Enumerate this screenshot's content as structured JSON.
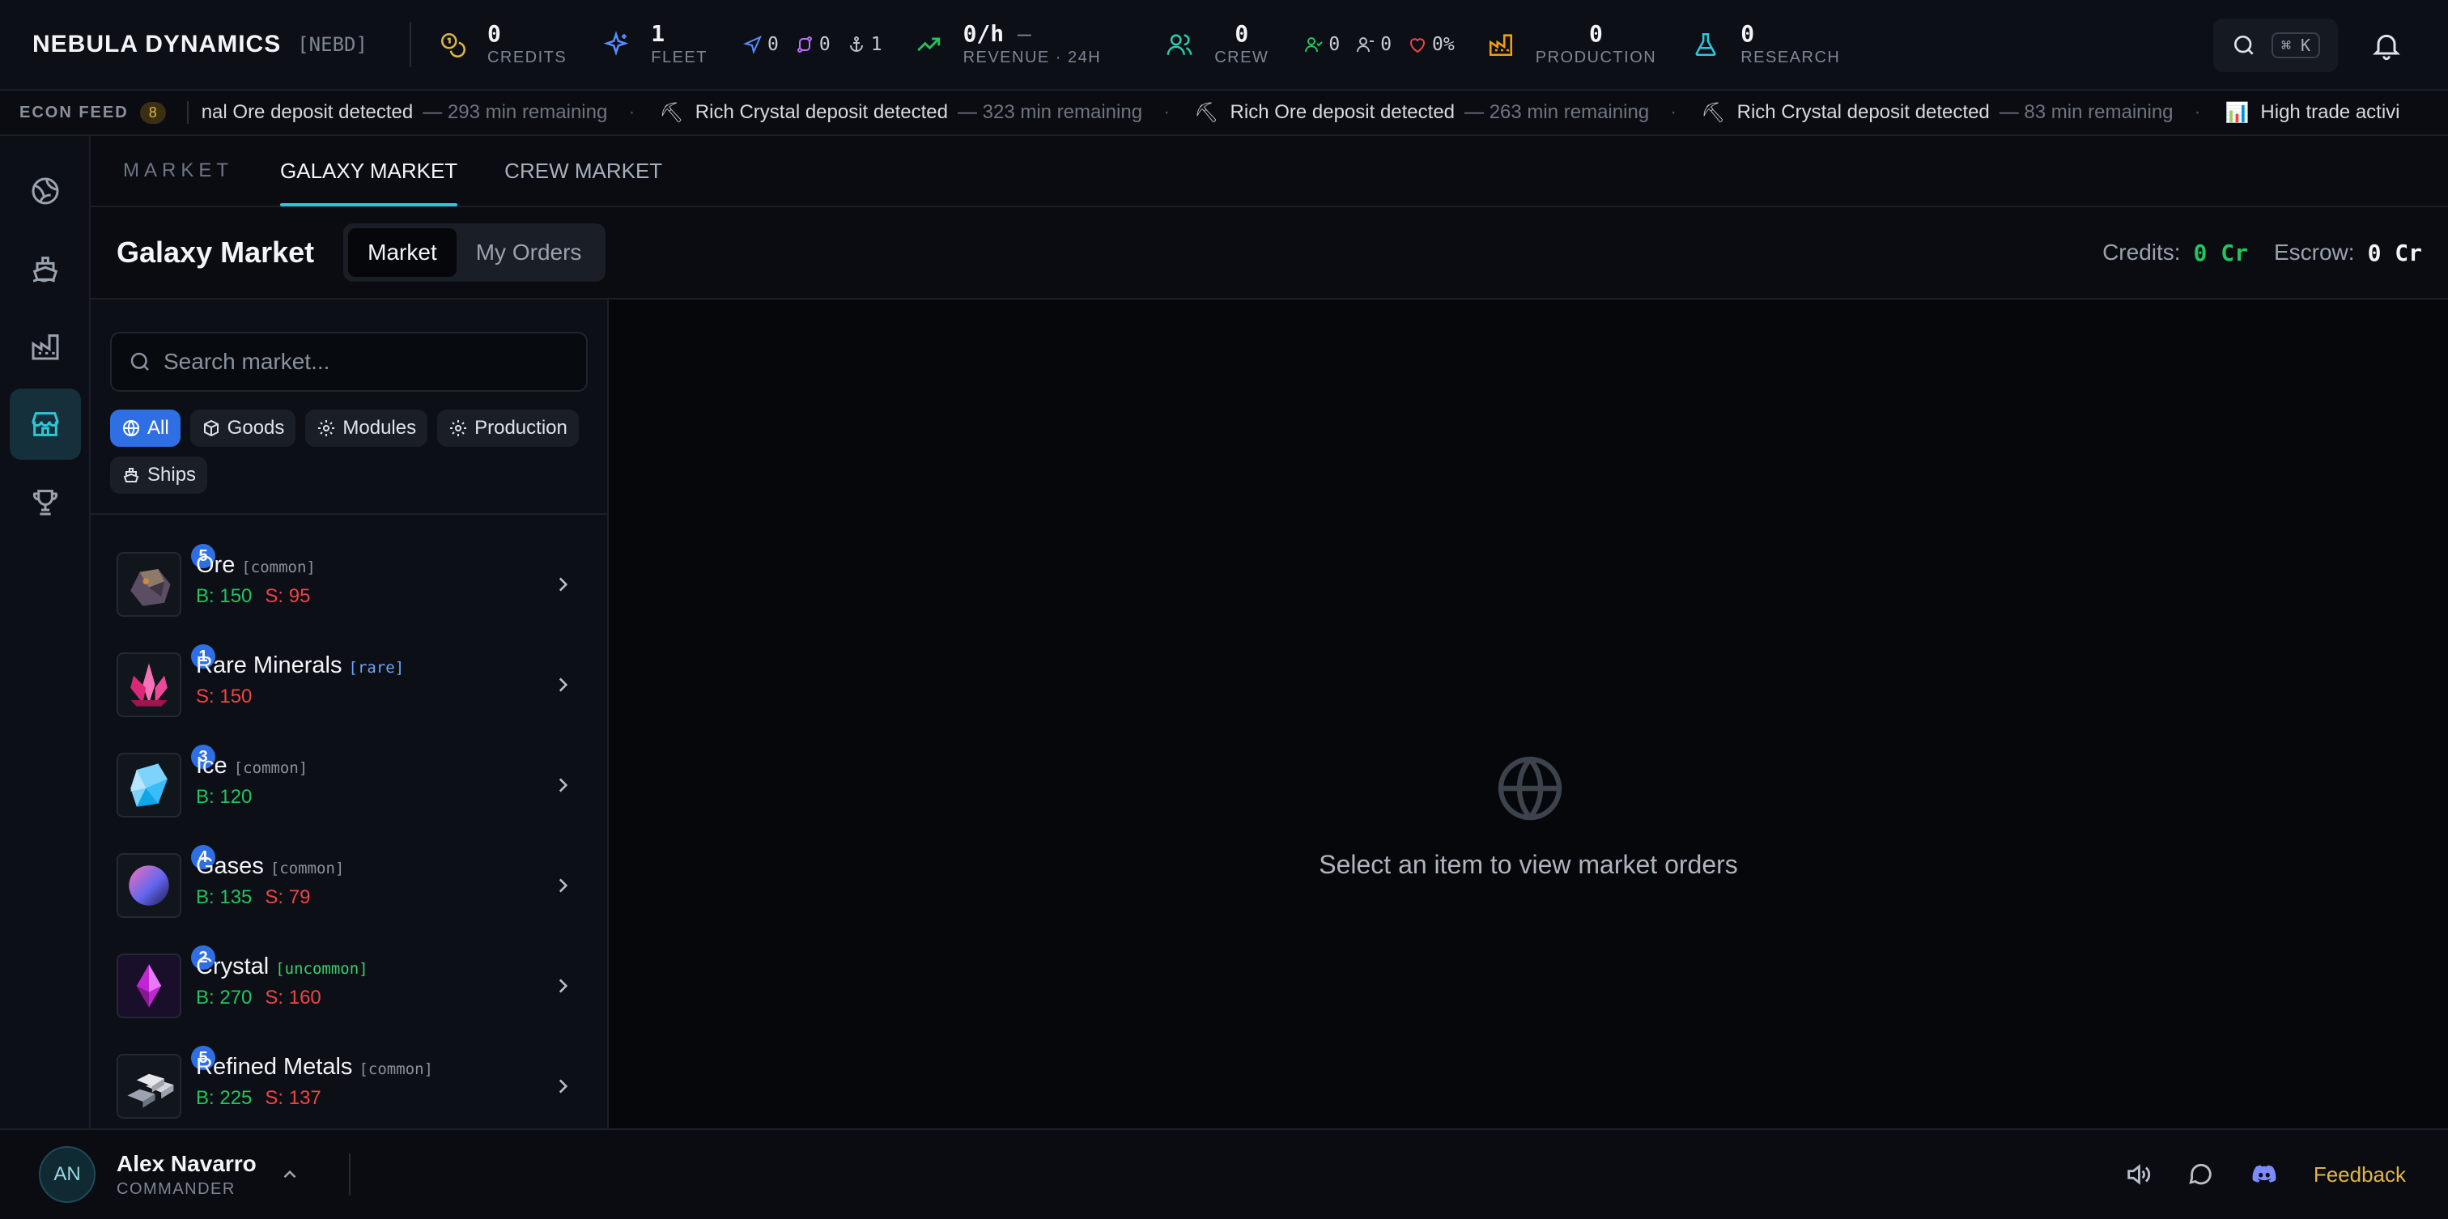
{
  "brand": {
    "name": "NEBULA DYNAMICS",
    "ticker": "[NEBD]"
  },
  "stats": {
    "credits": {
      "value": "0",
      "label": "CREDITS"
    },
    "fleet": {
      "value": "1",
      "label": "FLEET"
    },
    "fleet_minis": [
      "0",
      "0",
      "1"
    ],
    "revenue": {
      "value": "0/h",
      "trend": "—",
      "label": "REVENUE · 24H"
    },
    "crew": {
      "value": "0",
      "label": "CREW"
    },
    "crew_minis": [
      "0",
      "0",
      "0%"
    ],
    "production": {
      "value": "0",
      "label": "PRODUCTION"
    },
    "research": {
      "value": "0",
      "label": "RESEARCH"
    }
  },
  "search_shortcut": "⌘ K",
  "feed": {
    "label": "ECON FEED",
    "count": "8",
    "items": [
      {
        "icon": "mining-pick-icon",
        "text": "nal Ore deposit detected",
        "remaining": "— 293 min remaining"
      },
      {
        "icon": "mining-pick-icon",
        "text": "Rich Crystal deposit detected",
        "remaining": "— 323 min remaining"
      },
      {
        "icon": "mining-pick-icon",
        "text": "Rich Ore deposit detected",
        "remaining": "— 263 min remaining"
      },
      {
        "icon": "mining-pick-icon",
        "text": "Rich Crystal deposit detected",
        "remaining": "— 83 min remaining"
      },
      {
        "icon": "chart-icon",
        "text": "High trade activi",
        "remaining": ""
      }
    ]
  },
  "tabs": {
    "heading": "MARKET",
    "items": [
      "GALAXY MARKET",
      "CREW MARKET"
    ],
    "active": "GALAXY MARKET"
  },
  "header": {
    "title": "Galaxy Market",
    "segments": [
      "Market",
      "My Orders"
    ],
    "active_segment": "Market",
    "credits_label": "Credits:",
    "credits_value": "0 Cr",
    "escrow_label": "Escrow:",
    "escrow_value": "0 Cr"
  },
  "search": {
    "placeholder": "Search market..."
  },
  "filters": [
    "All",
    "Goods",
    "Modules",
    "Production",
    "Ships"
  ],
  "active_filter": "All",
  "items": [
    {
      "name": "Ore",
      "rarity": "[common]",
      "rarity_class": "common",
      "count": "5",
      "buy": "B: 150",
      "sell": "S: 95",
      "icon": "ore-icon"
    },
    {
      "name": "Rare Minerals",
      "rarity": "[rare]",
      "rarity_class": "rare",
      "count": "1",
      "buy": "",
      "sell": "S: 150",
      "icon": "rare-minerals-icon"
    },
    {
      "name": "Ice",
      "rarity": "[common]",
      "rarity_class": "common",
      "count": "3",
      "buy": "B: 120",
      "sell": "",
      "icon": "ice-icon"
    },
    {
      "name": "Gases",
      "rarity": "[common]",
      "rarity_class": "common",
      "count": "4",
      "buy": "B: 135",
      "sell": "S: 79",
      "icon": "gases-icon"
    },
    {
      "name": "Crystal",
      "rarity": "[uncommon]",
      "rarity_class": "uncommon",
      "count": "2",
      "buy": "B: 270",
      "sell": "S: 160",
      "icon": "crystal-icon"
    },
    {
      "name": "Refined Metals",
      "rarity": "[common]",
      "rarity_class": "common",
      "count": "5",
      "buy": "B: 225",
      "sell": "S: 137",
      "icon": "refined-metals-icon"
    }
  ],
  "empty_state": "Select an item to view market orders",
  "user": {
    "initials": "AN",
    "name": "Alex Navarro",
    "role": "COMMANDER"
  },
  "footer": {
    "feedback": "Feedback"
  },
  "colors": {
    "accent": "#2fc6d9",
    "primary": "#2f6fe4",
    "buy": "#22c55e",
    "sell": "#ef4444",
    "warning": "#e0b546"
  }
}
